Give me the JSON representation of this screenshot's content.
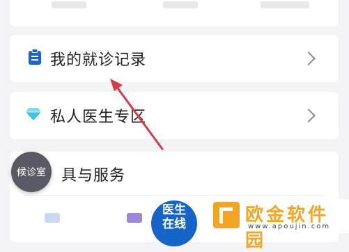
{
  "menu": {
    "items": [
      {
        "label": "我的就诊记录",
        "icon": "clipboard-icon"
      },
      {
        "label": "私人医生专区",
        "icon": "diamond-icon"
      }
    ]
  },
  "tools": {
    "title": "具与服务"
  },
  "floating": {
    "waiting_room": "候诊室",
    "doctor_online_line1": "医生",
    "doctor_online_line2": "在线"
  },
  "watermark": {
    "title": "欧金软件园",
    "url": "www.apoujin.com"
  },
  "colors": {
    "accent_blue": "#1565c8",
    "diamond": "#3ec4e8",
    "annotation_arrow": "#d9394a",
    "watermark_orange": "#f2a623"
  }
}
